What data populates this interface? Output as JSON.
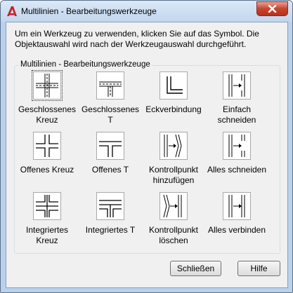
{
  "window": {
    "title": "Multilinien - Bearbeitungswerkzeuge",
    "app_icon": "autocad-logo-icon",
    "close_icon": "close-icon",
    "accent_color": "#c7452f"
  },
  "instruction": "Um ein Werkzeug zu verwenden, klicken Sie auf das Symbol. Die Objektauswahl wird nach der Werkzeugauswahl durchgeführt.",
  "group": {
    "label": "Multilinien - Bearbeitungswerkzeuge",
    "tools": [
      {
        "label": "Geschlossenes Kreuz",
        "icon": "closed-cross-icon",
        "selected": true
      },
      {
        "label": "Geschlossenes T",
        "icon": "closed-tee-icon"
      },
      {
        "label": "Eckverbindung",
        "icon": "corner-joint-icon"
      },
      {
        "label": "Einfach schneiden",
        "icon": "cut-single-icon"
      },
      {
        "label": "Offenes Kreuz",
        "icon": "open-cross-icon"
      },
      {
        "label": "Offenes T",
        "icon": "open-tee-icon"
      },
      {
        "label": "Kontrollpunkt hinzufügen",
        "icon": "add-vertex-icon"
      },
      {
        "label": "Alles schneiden",
        "icon": "cut-all-icon"
      },
      {
        "label": "Integriertes Kreuz",
        "icon": "merged-cross-icon"
      },
      {
        "label": "Integriertes T",
        "icon": "merged-tee-icon"
      },
      {
        "label": "Kontrollpunkt löschen",
        "icon": "delete-vertex-icon"
      },
      {
        "label": "Alles verbinden",
        "icon": "weld-all-icon"
      }
    ]
  },
  "buttons": {
    "close_label": "Schließen",
    "help_label": "Hilfe"
  }
}
